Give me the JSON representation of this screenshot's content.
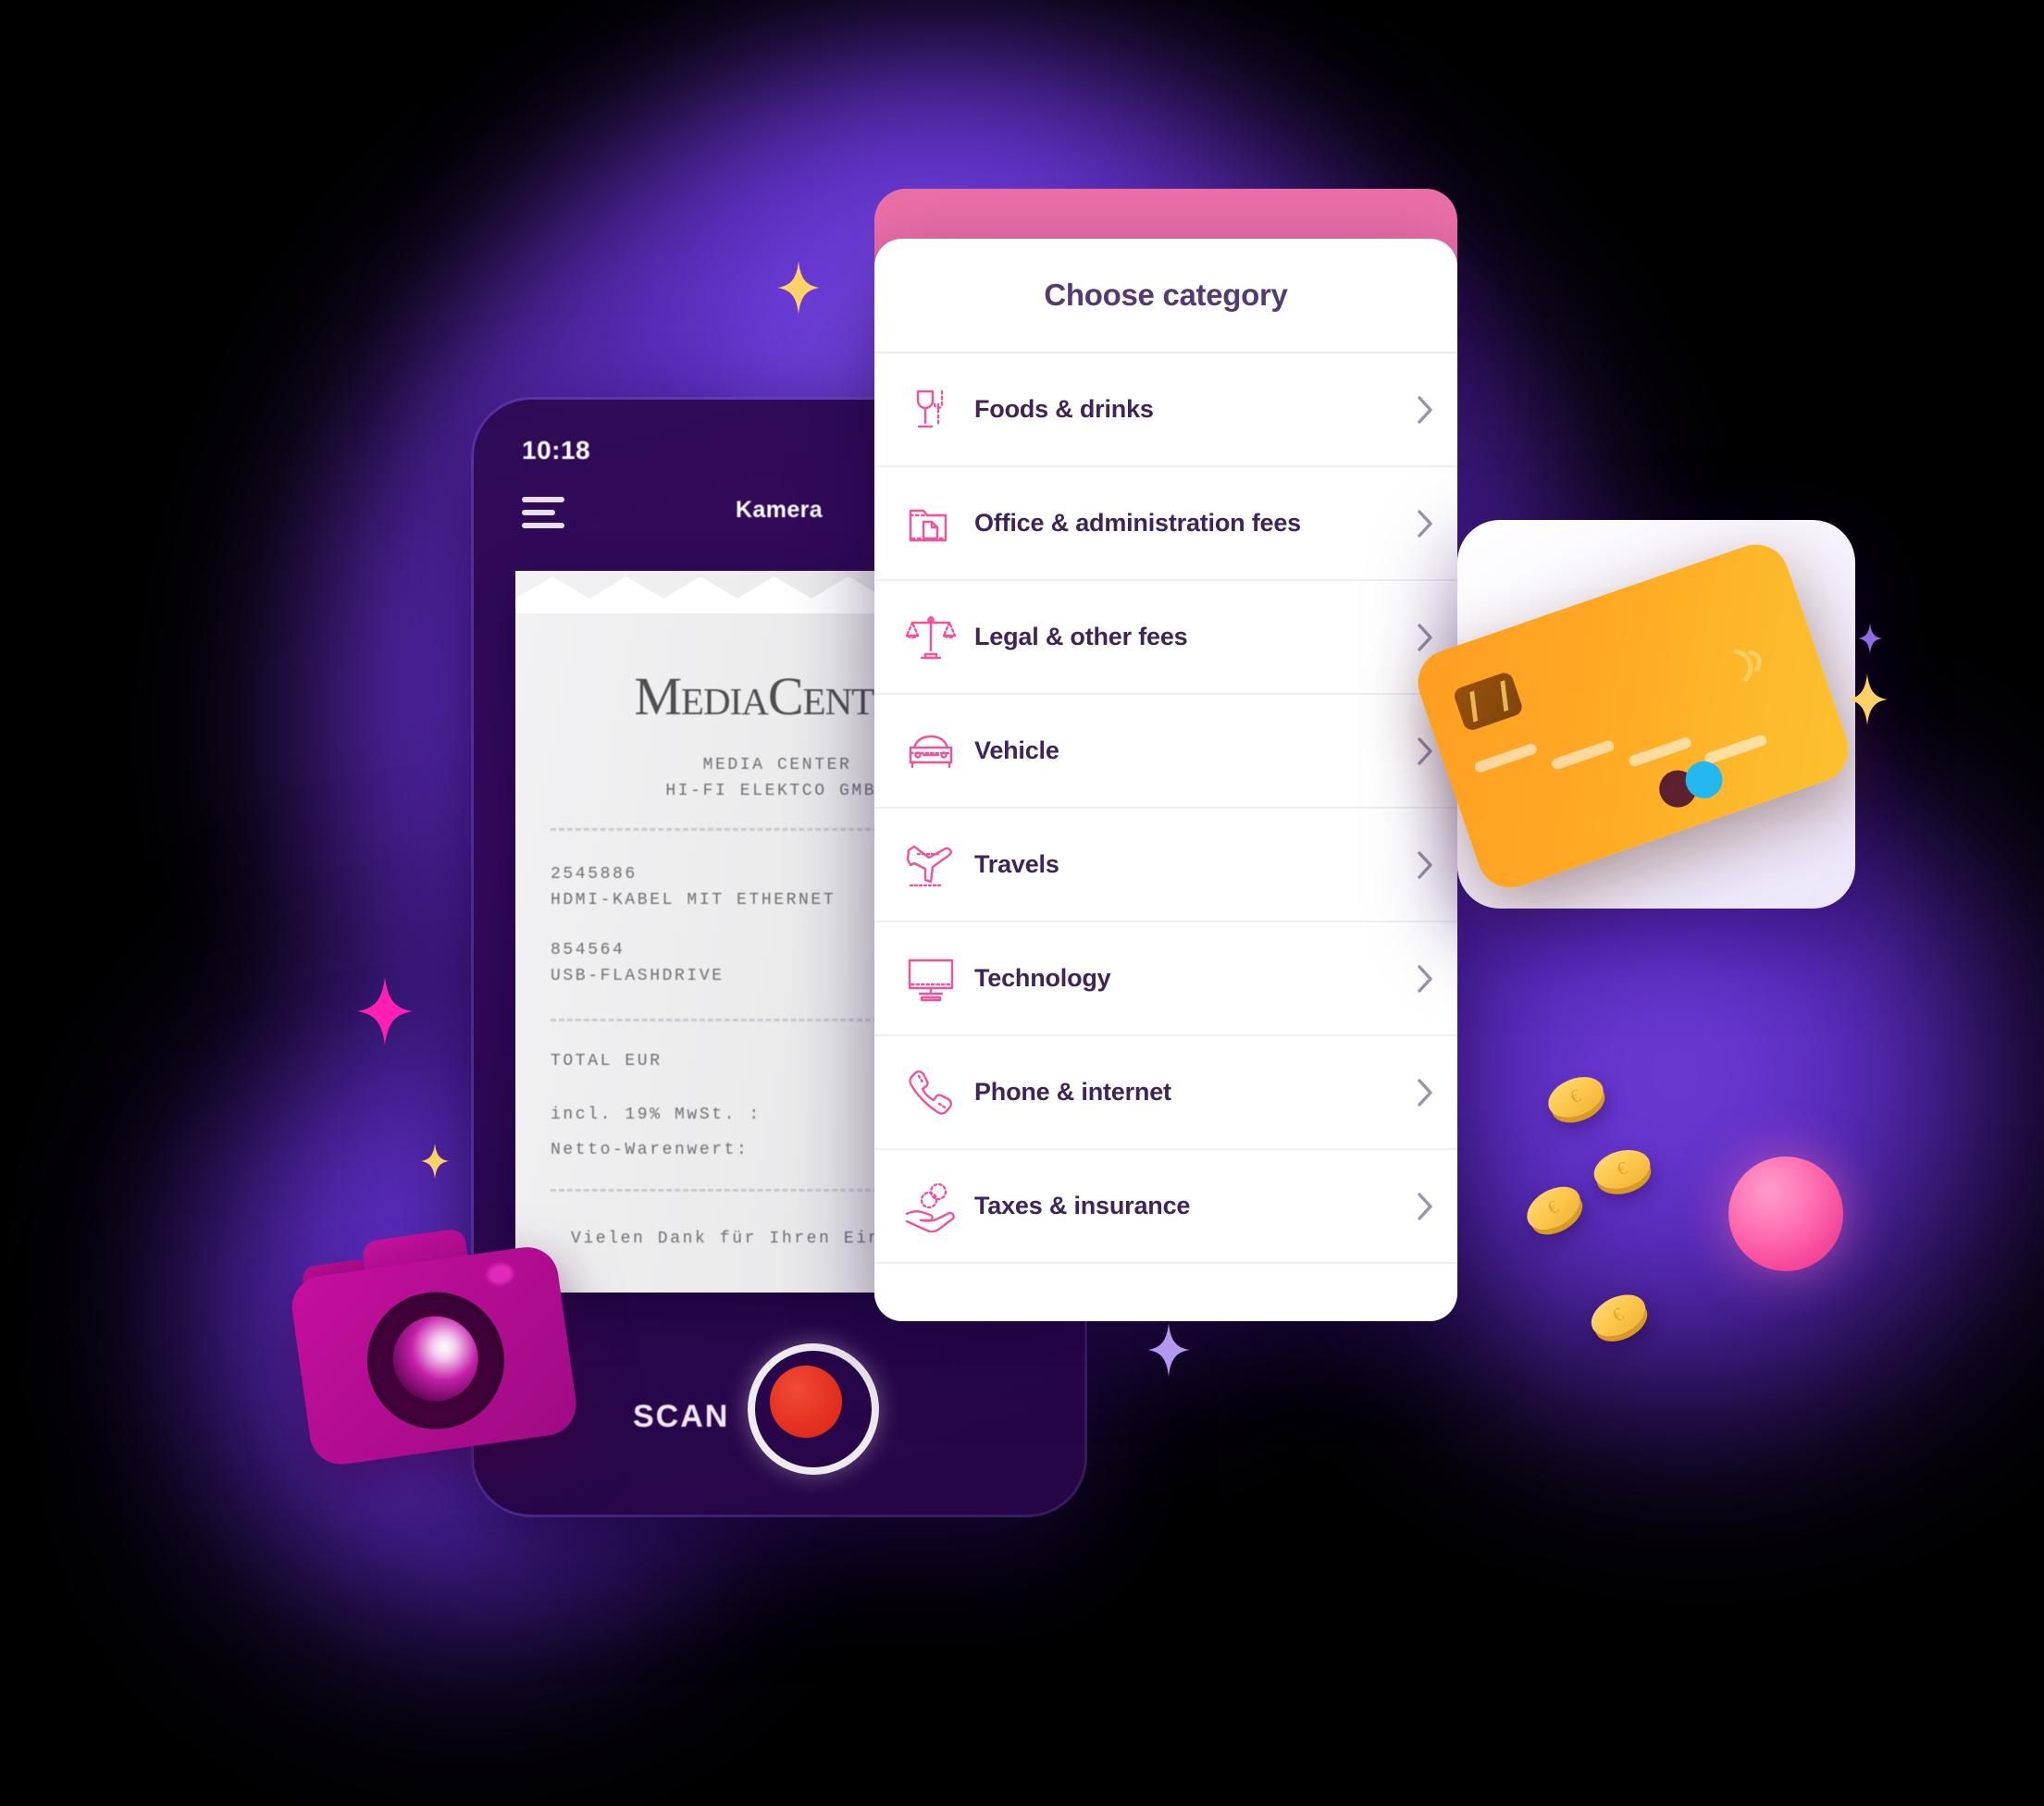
{
  "phone": {
    "status_time": "10:18",
    "menu_icon": "hamburger-menu-icon",
    "screen_title": "Kamera",
    "scan_label": "SCAN",
    "shutter_icon": "camera-shutter-icon"
  },
  "receipt": {
    "store_logo": "MediaCenter",
    "header_lines": [
      "MEDIA CENTER",
      "HI-FI ELEKTCO GMBH"
    ],
    "items": [
      {
        "code": "2545886",
        "description": "HDMI-KABEL MIT ETHERNET"
      },
      {
        "code": "854564",
        "description": "USB-FLASHDRIVE"
      }
    ],
    "total_label": "TOTAL EUR",
    "tax_line": "incl. 19% MwSt. :",
    "net_line": "Netto-Warenwert:",
    "footer": "Vielen Dank für Ihren Einkauf"
  },
  "category_card": {
    "title": "Choose category",
    "items": [
      {
        "label": "Foods & drinks",
        "icon": "wine-glass-fork-icon"
      },
      {
        "label": "Office & administration fees",
        "icon": "folder-document-icon"
      },
      {
        "label": "Legal & other fees",
        "icon": "scales-of-justice-icon"
      },
      {
        "label": "Vehicle",
        "icon": "car-front-icon"
      },
      {
        "label": "Travels",
        "icon": "airplane-icon"
      },
      {
        "label": "Technology",
        "icon": "desktop-monitor-icon"
      },
      {
        "label": "Phone & internet",
        "icon": "telephone-handset-icon"
      },
      {
        "label": "Taxes & insurance",
        "icon": "hand-with-coins-icon"
      }
    ],
    "row_chevron_icon": "chevron-right-icon"
  },
  "decorations": {
    "camera_illustration": "camera-illustration",
    "credit_card_orange": "orange-credit-card",
    "credit_card_white": "white-credit-card",
    "coins": "euro-coins",
    "pink_sphere": "pink-sphere",
    "sparkles": [
      "yellow-star-sparkle",
      "magenta-star-sparkle",
      "purple-star-sparkle"
    ]
  },
  "colors": {
    "accent_pink": "#ec6fa8",
    "icon_pink": "#f0529c",
    "text_purple": "#3f2557",
    "title_purple": "#543a72",
    "card_white": "#ffffff",
    "phone_purple": "#2f0b55",
    "shutter_red": "#e5301f",
    "card_orange": "#ffa824",
    "coin_gold": "#ffc94f",
    "glow_violet": "#7b45e0"
  }
}
